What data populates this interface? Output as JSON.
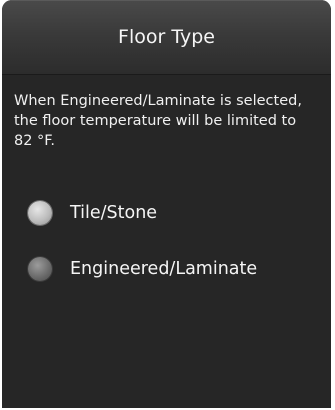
{
  "header": {
    "title": "Floor Type"
  },
  "description": "When Engineered/Laminate is selected, the floor temperature will be limited to 82 °F.",
  "options": [
    {
      "label": "Tile/Stone",
      "selected": true
    },
    {
      "label": "Engineered/Laminate",
      "selected": false
    }
  ]
}
